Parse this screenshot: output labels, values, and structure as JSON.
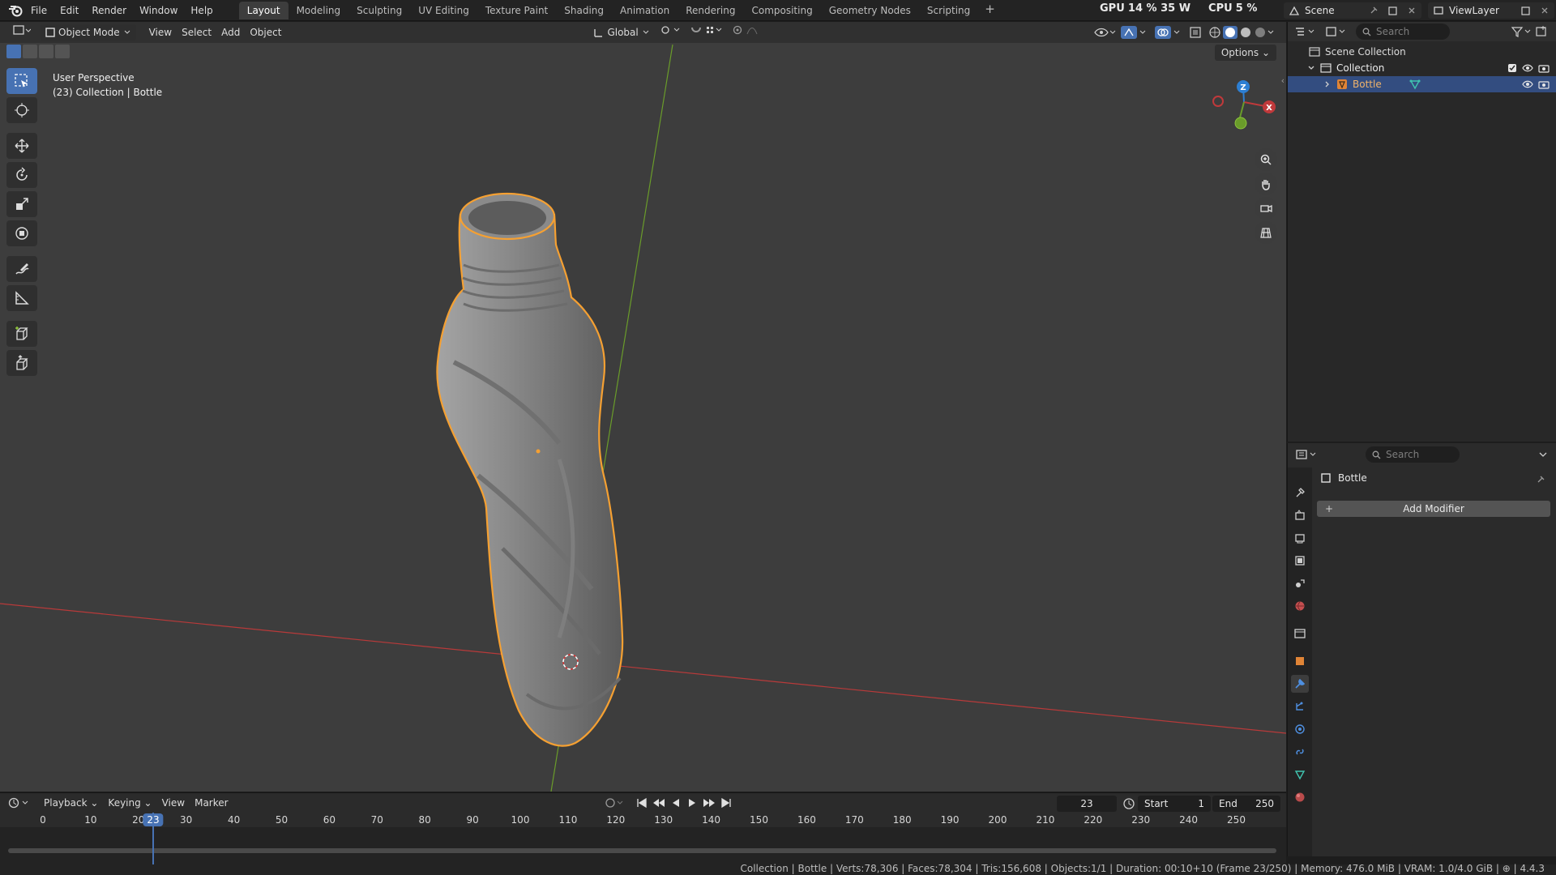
{
  "menu": {
    "items": [
      "File",
      "Edit",
      "Render",
      "Window",
      "Help"
    ],
    "workspaces": [
      "Layout",
      "Modeling",
      "Sculpting",
      "UV Editing",
      "Texture Paint",
      "Shading",
      "Animation",
      "Rendering",
      "Compositing",
      "Geometry Nodes",
      "Scripting"
    ],
    "active_workspace": "Layout",
    "gpu_label": "GPU",
    "gpu_value": "14 % 35 W",
    "cpu_label": "CPU",
    "cpu_value": "5 %",
    "scene": "Scene",
    "view_layer": "ViewLayer"
  },
  "viewport": {
    "mode": "Object Mode",
    "menus": [
      "View",
      "Select",
      "Add",
      "Object"
    ],
    "transform_orientation": "Global",
    "options_label": "Options",
    "perspective": "User Perspective",
    "info": "(23) Collection | Bottle",
    "gizmo_axes": [
      "Z",
      "X"
    ]
  },
  "outliner": {
    "search_placeholder": "Search",
    "scene_collection": "Scene Collection",
    "collection": "Collection",
    "object": "Bottle"
  },
  "properties": {
    "search_placeholder": "Search",
    "object_name": "Bottle",
    "add_modifier": "Add Modifier"
  },
  "timeline": {
    "menus": [
      "Playback",
      "Keying",
      "View",
      "Marker"
    ],
    "current_frame": "23",
    "start_label": "Start",
    "start": "1",
    "end_label": "End",
    "end": "250",
    "ruler": [
      "0",
      "10",
      "20",
      "30",
      "40",
      "50",
      "60",
      "70",
      "80",
      "90",
      "100",
      "110",
      "120",
      "130",
      "140",
      "150",
      "160",
      "170",
      "180",
      "190",
      "200",
      "210",
      "220",
      "230",
      "240",
      "250"
    ]
  },
  "status": {
    "text": "Collection | Bottle | Verts:78,306 | Faces:78,304 | Tris:156,608 | Objects:1/1 | Duration: 00:10+10 (Frame 23/250) | Memory: 476.0 MiB | VRAM: 1.0/4.0 GiB | ⊕ | 4.4.3"
  },
  "colors": {
    "accent": "#4772b3",
    "selection_outline": "#f5a032",
    "x_axis": "#c0393b",
    "y_axis": "#6a9c2a",
    "z_axis": "#2d7fd3"
  }
}
